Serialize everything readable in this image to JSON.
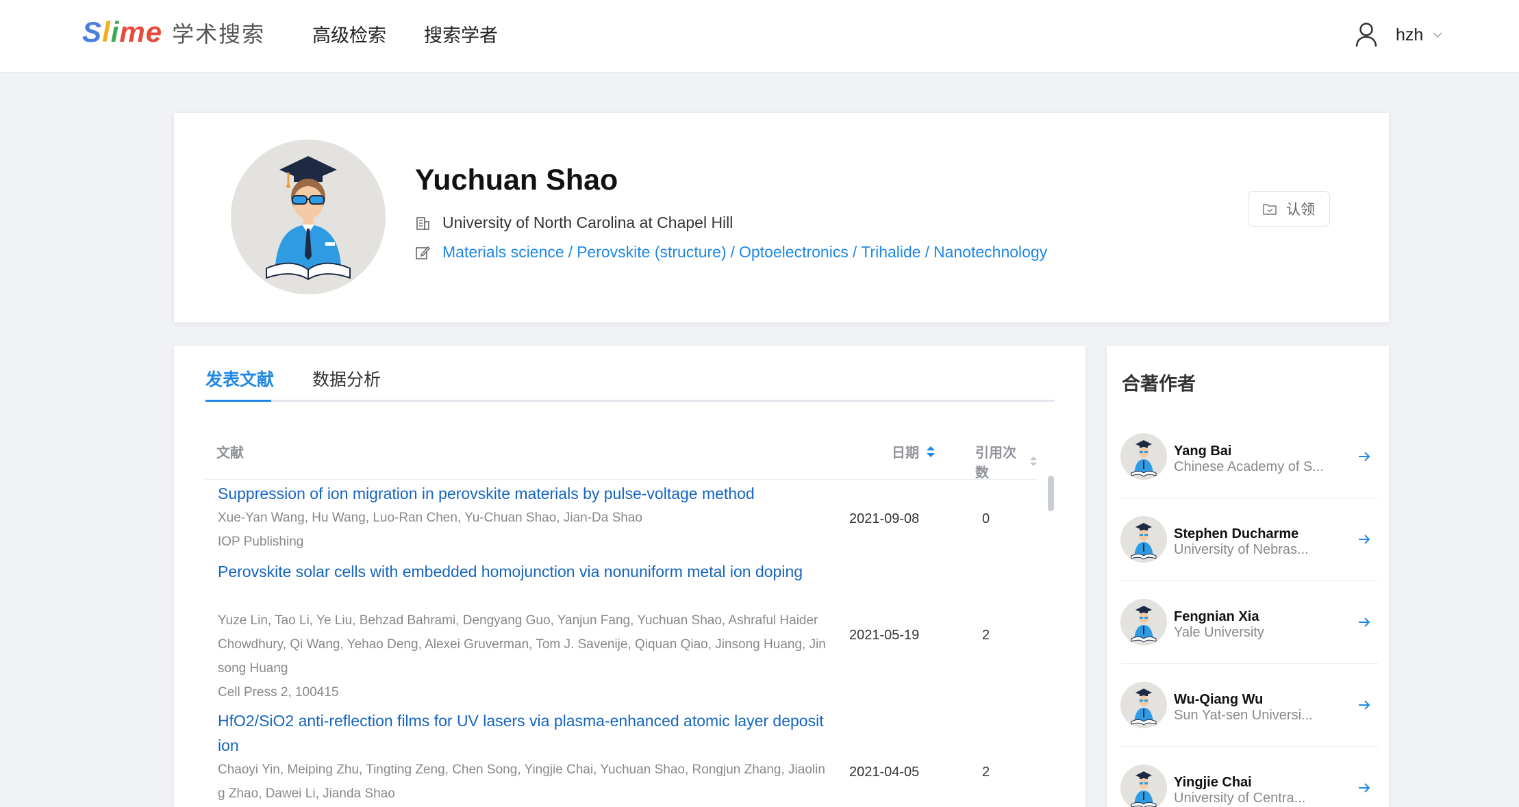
{
  "header": {
    "logo": {
      "letters": [
        "S",
        "l",
        "i",
        "m",
        "e"
      ],
      "colors": [
        "#4a7fe0",
        "#f2b01e",
        "#3aaa55",
        "#e84b3c",
        "#e84b3c"
      ],
      "subtitle": "学术搜索"
    },
    "nav": {
      "advanced_search": "高级检索",
      "search_scholar": "搜索学者"
    },
    "user": {
      "name": "hzh",
      "icon": "user-icon",
      "caret": "chevron-down-icon"
    }
  },
  "profile": {
    "name": "Yuchuan Shao",
    "institution": "University of North Carolina at Chapel Hill",
    "institution_icon": "building-icon",
    "tags_icon": "edit-icon",
    "tags": [
      "Materials science",
      "Perovskite (structure)",
      "Optoelectronics",
      "Trihalide",
      "Nanotechnology"
    ],
    "tag_separator": "/",
    "claim_label": "认领",
    "claim_icon": "folder-icon"
  },
  "papers": {
    "tabs": [
      {
        "label": "发表文献",
        "active": true
      },
      {
        "label": "数据分析",
        "active": false
      }
    ],
    "columns": {
      "doc": "文献",
      "date": "日期",
      "citations": "引用次数"
    },
    "rows": [
      {
        "title": "Suppression of ion migration in perovskite materials by pulse-voltage method",
        "authors": "Xue-Yan Wang, Hu Wang, Luo-Ran Chen, Yu-Chuan Shao, Jian-Da Shao",
        "venue": "IOP Publishing",
        "date": "2021-09-08",
        "citations": "0"
      },
      {
        "title": "Perovskite solar cells with embedded homojunction via nonuniform metal ion doping",
        "authors": "Yuze Lin, Tao Li, Ye Liu, Behzad Bahrami, Dengyang Guo, Yanjun Fang, Yuchuan Shao, Ashraful Haider Chowdhury, Qi Wang, Yehao Deng, Alexei Gruverman, Tom J. Savenije, Qiquan Qiao, Jinsong Huang, Jinsong Huang",
        "venue": "Cell Press 2, 100415",
        "date": "2021-05-19",
        "citations": "2"
      },
      {
        "title": "HfO2/SiO2 anti-reflection films for UV lasers via plasma-enhanced atomic layer deposition",
        "authors": "Chaoyi Yin, Meiping Zhu, Tingting Zeng, Chen Song, Yingjie Chai, Yuchuan Shao, Rongjun Zhang, Jiaoling Zhao, Dawei Li, Jianda Shao",
        "venue": "",
        "date": "2021-04-05",
        "citations": "2"
      }
    ]
  },
  "coauthors": {
    "title": "合著作者",
    "items": [
      {
        "name": "Yang Bai",
        "affiliation": "Chinese Academy of S..."
      },
      {
        "name": "Stephen Ducharme",
        "affiliation": "University of Nebras..."
      },
      {
        "name": "Fengnian Xia",
        "affiliation": "Yale University"
      },
      {
        "name": "Wu-Qiang Wu",
        "affiliation": "Sun Yat-sen Universi..."
      },
      {
        "name": "Yingjie Chai",
        "affiliation": "University of Centra..."
      }
    ]
  },
  "colors": {
    "accent": "#1e88e5",
    "link": "#1565c0",
    "page_bg": "#f0f2f5"
  }
}
